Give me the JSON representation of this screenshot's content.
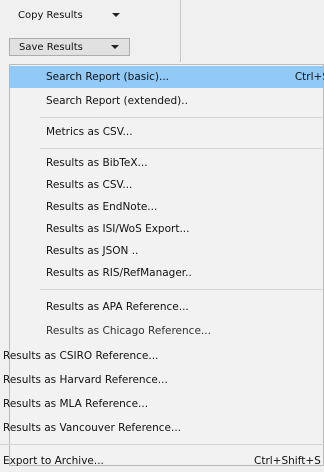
{
  "toolbar": {
    "copy_label": "Copy Results",
    "save_label": "Save Results"
  },
  "menu": {
    "items": [
      {
        "label": "Search Report (basic)...",
        "shortcut": "Ctrl+S"
      },
      {
        "label": "Search Report (extended)..",
        "shortcut": ""
      },
      {
        "label": "Metrics as CSV...",
        "shortcut": ""
      },
      {
        "label": "Results as BibTeX...",
        "shortcut": ""
      },
      {
        "label": "Results as CSV...",
        "shortcut": ""
      },
      {
        "label": "Results as EndNote...",
        "shortcut": ""
      },
      {
        "label": "Results as ISI/WoS Export...",
        "shortcut": ""
      },
      {
        "label": "Results as JSON ..",
        "shortcut": ""
      },
      {
        "label": "Results as RIS/RefManager..",
        "shortcut": ""
      },
      {
        "label": "Results as APA Reference...",
        "shortcut": ""
      },
      {
        "label": "Results as Chicago Reference...",
        "shortcut": ""
      }
    ],
    "outer_items": [
      {
        "label": "Results as CSIRO Reference...",
        "shortcut": ""
      },
      {
        "label": "Results as Harvard Reference...",
        "shortcut": ""
      },
      {
        "label": "Results as MLA Reference...",
        "shortcut": ""
      },
      {
        "label": "Results as Vancouver Reference...",
        "shortcut": ""
      },
      {
        "label": "Export to Archive...",
        "shortcut": "Ctrl+Shift+S"
      }
    ]
  },
  "colors": {
    "highlight": "#91c9f7",
    "menu_bg": "#f2f2f2",
    "separator": "#d4d4d4"
  }
}
